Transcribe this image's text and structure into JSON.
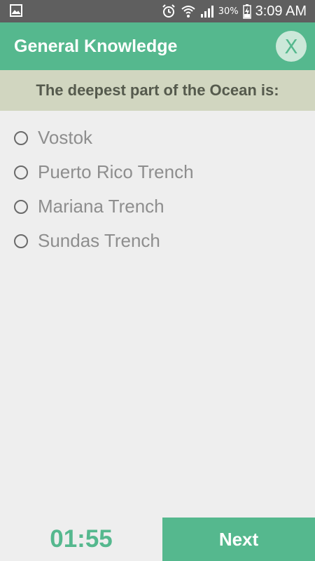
{
  "status_bar": {
    "battery_percent": "30%",
    "time": "3:09 AM",
    "icons": [
      "gallery-icon",
      "alarm-icon",
      "wifi-icon",
      "signal-icon",
      "battery-charging-icon"
    ]
  },
  "app_bar": {
    "title": "General Knowledge",
    "close_label": "X"
  },
  "question": {
    "text": "The deepest part of the Ocean is:"
  },
  "options": [
    {
      "label": "Vostok",
      "selected": false
    },
    {
      "label": "Puerto Rico Trench",
      "selected": false
    },
    {
      "label": "Mariana Trench",
      "selected": false
    },
    {
      "label": "Sundas Trench",
      "selected": false
    }
  ],
  "footer": {
    "timer": "01:55",
    "next_label": "Next"
  },
  "colors": {
    "accent": "#55b88e",
    "status_bar": "#5f5f5f",
    "question_bg": "#d1d6c0",
    "background": "#eeeeee"
  }
}
